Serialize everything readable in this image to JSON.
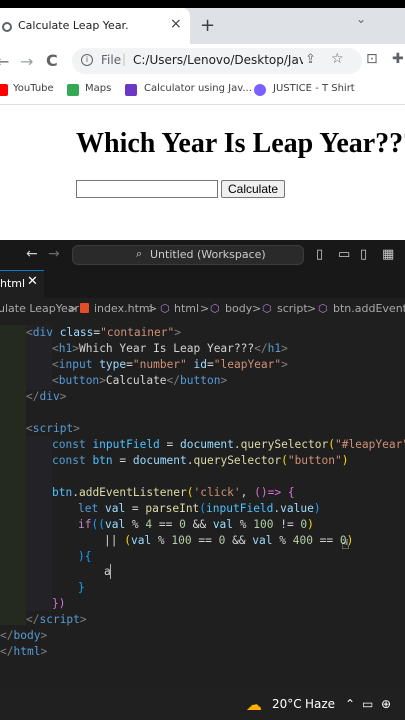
{
  "browser": {
    "tab_title": "Calculate Leap Year.",
    "tab_close": "×",
    "new_tab": "+",
    "tab_search": "⌄",
    "back": "←",
    "forward": "→",
    "reload": "C",
    "info_icon": "i",
    "file_label": "File",
    "separator": "|",
    "url": "C:/Users/Lenovo/Desktop/Jav...",
    "share": "⇪",
    "star": "☆",
    "ext1": "⊡",
    "ext2": "✚",
    "bookmarks": [
      {
        "label": "YouTube",
        "color": "#ff0000"
      },
      {
        "label": "Maps",
        "color": "#34a853"
      },
      {
        "label": "Calculator using Jav...",
        "color": "#6a38c2"
      },
      {
        "label": "JUSTICE - T Shirt",
        "color": "#7b61ff"
      }
    ]
  },
  "page": {
    "heading": "Which Year Is Leap Year???",
    "input_value": "",
    "button_label": "Calculate"
  },
  "vscode": {
    "search_text": "Untitled (Workspace)",
    "search_icon": "⌕",
    "back": "←",
    "forward": "→",
    "active_tab": "html",
    "active_tab_close": "✕",
    "breadcrumbs": [
      "ulate LeapYear",
      ">",
      "index.html",
      ">",
      "html",
      ">",
      "body",
      ">",
      "script",
      ">",
      "btn.addEventLi"
    ],
    "layout_icons": [
      "▯",
      "▭",
      "▯",
      "▦"
    ]
  },
  "code": {
    "l1": [
      "<",
      "div",
      " ",
      "class",
      "=",
      "\"container\"",
      ">"
    ],
    "l2": [
      "<",
      "h1",
      ">",
      "Which Year Is Leap Year???",
      "</",
      "h1",
      ">"
    ],
    "l3": [
      "<",
      "input",
      " ",
      "type",
      "=",
      "\"number\"",
      " ",
      "id",
      "=",
      "\"leapYear\"",
      ">"
    ],
    "l4": [
      "<",
      "button",
      ">",
      "Calculate",
      "</",
      "button",
      ">"
    ],
    "l5": [
      "</",
      "div",
      ">"
    ],
    "l6": [
      "<",
      "script",
      ">"
    ],
    "l7": [
      "const",
      " ",
      "inputField",
      " = ",
      "document",
      ".",
      "querySelector",
      "(",
      "\"#leapYear\"",
      ")"
    ],
    "l8": [
      "const",
      " ",
      "btn",
      " = ",
      "document",
      ".",
      "querySelector",
      "(",
      "\"button\"",
      ")"
    ],
    "l9": [
      "btn",
      ".",
      "addEventListener",
      "(",
      "'click'",
      ", ",
      "()=>",
      " {"
    ],
    "l10": [
      "let",
      " ",
      "val",
      " = ",
      "parseInt",
      "(",
      "inputField",
      ".",
      "value",
      ")"
    ],
    "l11": [
      "if",
      "((",
      "val",
      " % ",
      "4",
      " == ",
      "0",
      " && ",
      "val",
      " % ",
      "100",
      " != ",
      "0",
      ")"
    ],
    "l12": [
      "|| ",
      "(",
      "val",
      " % ",
      "100",
      " == ",
      "0",
      " && ",
      "val",
      " % ",
      "400",
      " == ",
      "0",
      ")"
    ],
    "l13": [
      "){"
    ],
    "l14": [
      "a"
    ],
    "l15": [
      "}"
    ],
    "l16": [
      "})"
    ],
    "l17": [
      "</",
      "script",
      ">"
    ],
    "l18": [
      "</",
      "body",
      ">"
    ],
    "l19": [
      "</",
      "html",
      ">"
    ]
  },
  "taskbar": {
    "weather_icon": "☁",
    "temperature": "20°C",
    "condition": "Haze",
    "tray_arrow": "⌃",
    "tray_battery": "▭",
    "tray_globe": "⊕"
  }
}
